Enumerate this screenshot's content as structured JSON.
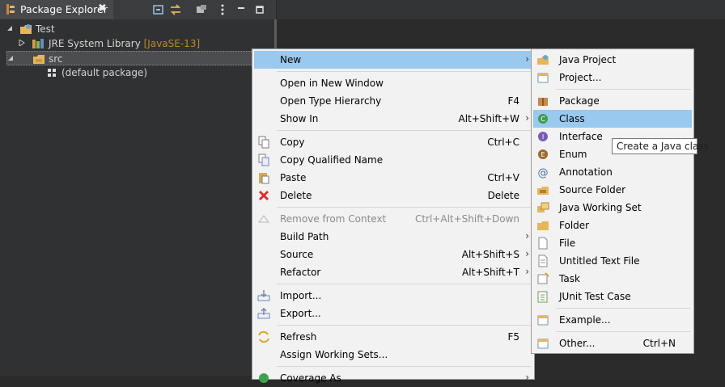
{
  "package_explorer": {
    "tab_title": "Package Explorer",
    "close_glyph": "✖",
    "toolbar": [
      "collapse-all-icon",
      "link-with-editor-icon",
      "filters-icon",
      "view-menu-icon",
      "minimize-icon",
      "maximize-icon"
    ],
    "tree": {
      "project": "Test",
      "jre_library": "JRE System Library",
      "jre_version": "[JavaSE-13]",
      "src": "src",
      "default_package": "(default package)"
    }
  },
  "context_menu": {
    "items": [
      {
        "label": "New",
        "accel": "",
        "submenu": true,
        "highlighted": true
      },
      {
        "label": "Open in New Window",
        "accel": ""
      },
      {
        "label": "Open Type Hierarchy",
        "accel": "F4"
      },
      {
        "label": "Show In",
        "accel": "Alt+Shift+W",
        "submenu": true
      },
      {
        "label": "Copy",
        "accel": "Ctrl+C",
        "icon": "copy-icon"
      },
      {
        "label": "Copy Qualified Name",
        "accel": "",
        "icon": "copy-qualified-name-icon"
      },
      {
        "label": "Paste",
        "accel": "Ctrl+V",
        "icon": "paste-icon"
      },
      {
        "label": "Delete",
        "accel": "Delete",
        "icon": "delete-icon"
      },
      {
        "label": "Remove from Context",
        "accel": "Ctrl+Alt+Shift+Down",
        "disabled": true,
        "icon": "remove-context-icon"
      },
      {
        "label": "Build Path",
        "accel": "",
        "submenu": true
      },
      {
        "label": "Source",
        "accel": "Alt+Shift+S",
        "submenu": true
      },
      {
        "label": "Refactor",
        "accel": "Alt+Shift+T",
        "submenu": true
      },
      {
        "label": "Import...",
        "accel": "",
        "icon": "import-icon"
      },
      {
        "label": "Export...",
        "accel": "",
        "icon": "export-icon"
      },
      {
        "label": "Refresh",
        "accel": "F5",
        "icon": "refresh-icon"
      },
      {
        "label": "Assign Working Sets...",
        "accel": ""
      },
      {
        "label": "Coverage As",
        "accel": "",
        "submenu": true,
        "icon": "coverage-icon"
      }
    ]
  },
  "new_submenu": {
    "items": [
      {
        "label": "Java Project",
        "accel": "",
        "icon": "java-project-icon"
      },
      {
        "label": "Project...",
        "accel": "",
        "icon": "project-icon"
      },
      {
        "label": "Package",
        "accel": "",
        "icon": "package-icon"
      },
      {
        "label": "Class",
        "accel": "",
        "icon": "class-icon",
        "highlighted": true
      },
      {
        "label": "Interface",
        "accel": "",
        "icon": "interface-icon"
      },
      {
        "label": "Enum",
        "accel": "",
        "icon": "enum-icon"
      },
      {
        "label": "Annotation",
        "accel": "",
        "icon": "annotation-icon"
      },
      {
        "label": "Source Folder",
        "accel": "",
        "icon": "source-folder-icon"
      },
      {
        "label": "Java Working Set",
        "accel": "",
        "icon": "working-set-icon"
      },
      {
        "label": "Folder",
        "accel": "",
        "icon": "folder-icon"
      },
      {
        "label": "File",
        "accel": "",
        "icon": "file-icon"
      },
      {
        "label": "Untitled Text File",
        "accel": "",
        "icon": "untitled-text-file-icon"
      },
      {
        "label": "Task",
        "accel": "",
        "icon": "task-icon"
      },
      {
        "label": "JUnit Test Case",
        "accel": "",
        "icon": "junit-test-case-icon"
      },
      {
        "label": "Example...",
        "accel": "",
        "icon": "example-icon"
      },
      {
        "label": "Other...",
        "accel": "Ctrl+N",
        "icon": "other-icon"
      }
    ]
  },
  "tooltip": "Create a Java class",
  "colors": {
    "highlight": "#99c9ef",
    "menu_bg": "#f2f2f2",
    "panel_bg": "#303132"
  }
}
